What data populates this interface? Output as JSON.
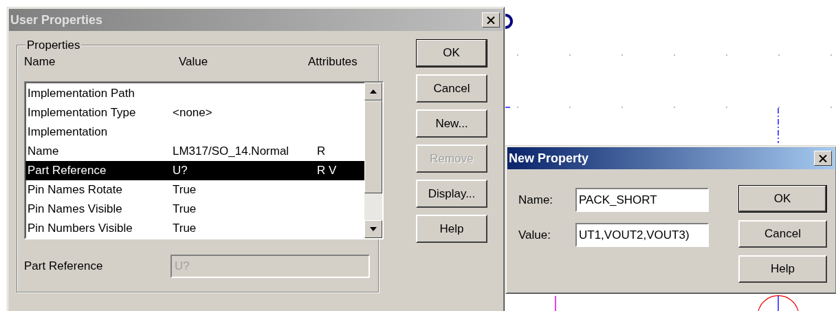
{
  "user_properties": {
    "title": "User Properties",
    "active": false,
    "group_label": "Properties",
    "columns": [
      "Name",
      "Value",
      "Attributes"
    ],
    "rows": [
      {
        "name": "Implementation Path",
        "value": "",
        "attributes": "",
        "selected": false
      },
      {
        "name": "Implementation Type",
        "value": "<none>",
        "attributes": "",
        "selected": false
      },
      {
        "name": "Implementation",
        "value": "",
        "attributes": "",
        "selected": false
      },
      {
        "name": "Name",
        "value": "LM317/SO_14.Normal",
        "attributes": "R",
        "selected": false
      },
      {
        "name": "Part Reference",
        "value": "U?",
        "attributes": "R V",
        "selected": true
      },
      {
        "name": "Pin Names Rotate",
        "value": "True",
        "attributes": "",
        "selected": false
      },
      {
        "name": "Pin Names Visible",
        "value": "True",
        "attributes": "",
        "selected": false
      },
      {
        "name": "Pin Numbers Visible",
        "value": "True",
        "attributes": "",
        "selected": false
      }
    ],
    "field": {
      "label": "Part Reference",
      "value": "U?",
      "disabled": true
    },
    "buttons": [
      {
        "label": "OK",
        "default": true,
        "disabled": false
      },
      {
        "label": "Cancel",
        "default": false,
        "disabled": false
      },
      {
        "label": "New...",
        "default": false,
        "disabled": false
      },
      {
        "label": "Remove",
        "default": false,
        "disabled": true
      },
      {
        "label": "Display...",
        "default": false,
        "disabled": false
      },
      {
        "label": "Help",
        "default": false,
        "disabled": false
      }
    ]
  },
  "new_property": {
    "title": "New Property",
    "active": true,
    "fields": [
      {
        "label": "Name:",
        "value": "PACK_SHORT"
      },
      {
        "label": "Value:",
        "value": "UT1,VOUT2,VOUT3)"
      }
    ],
    "buttons": [
      {
        "label": "OK",
        "default": true,
        "disabled": false
      },
      {
        "label": "Cancel",
        "default": false,
        "disabled": false
      },
      {
        "label": "Help",
        "default": false,
        "disabled": false
      }
    ]
  }
}
